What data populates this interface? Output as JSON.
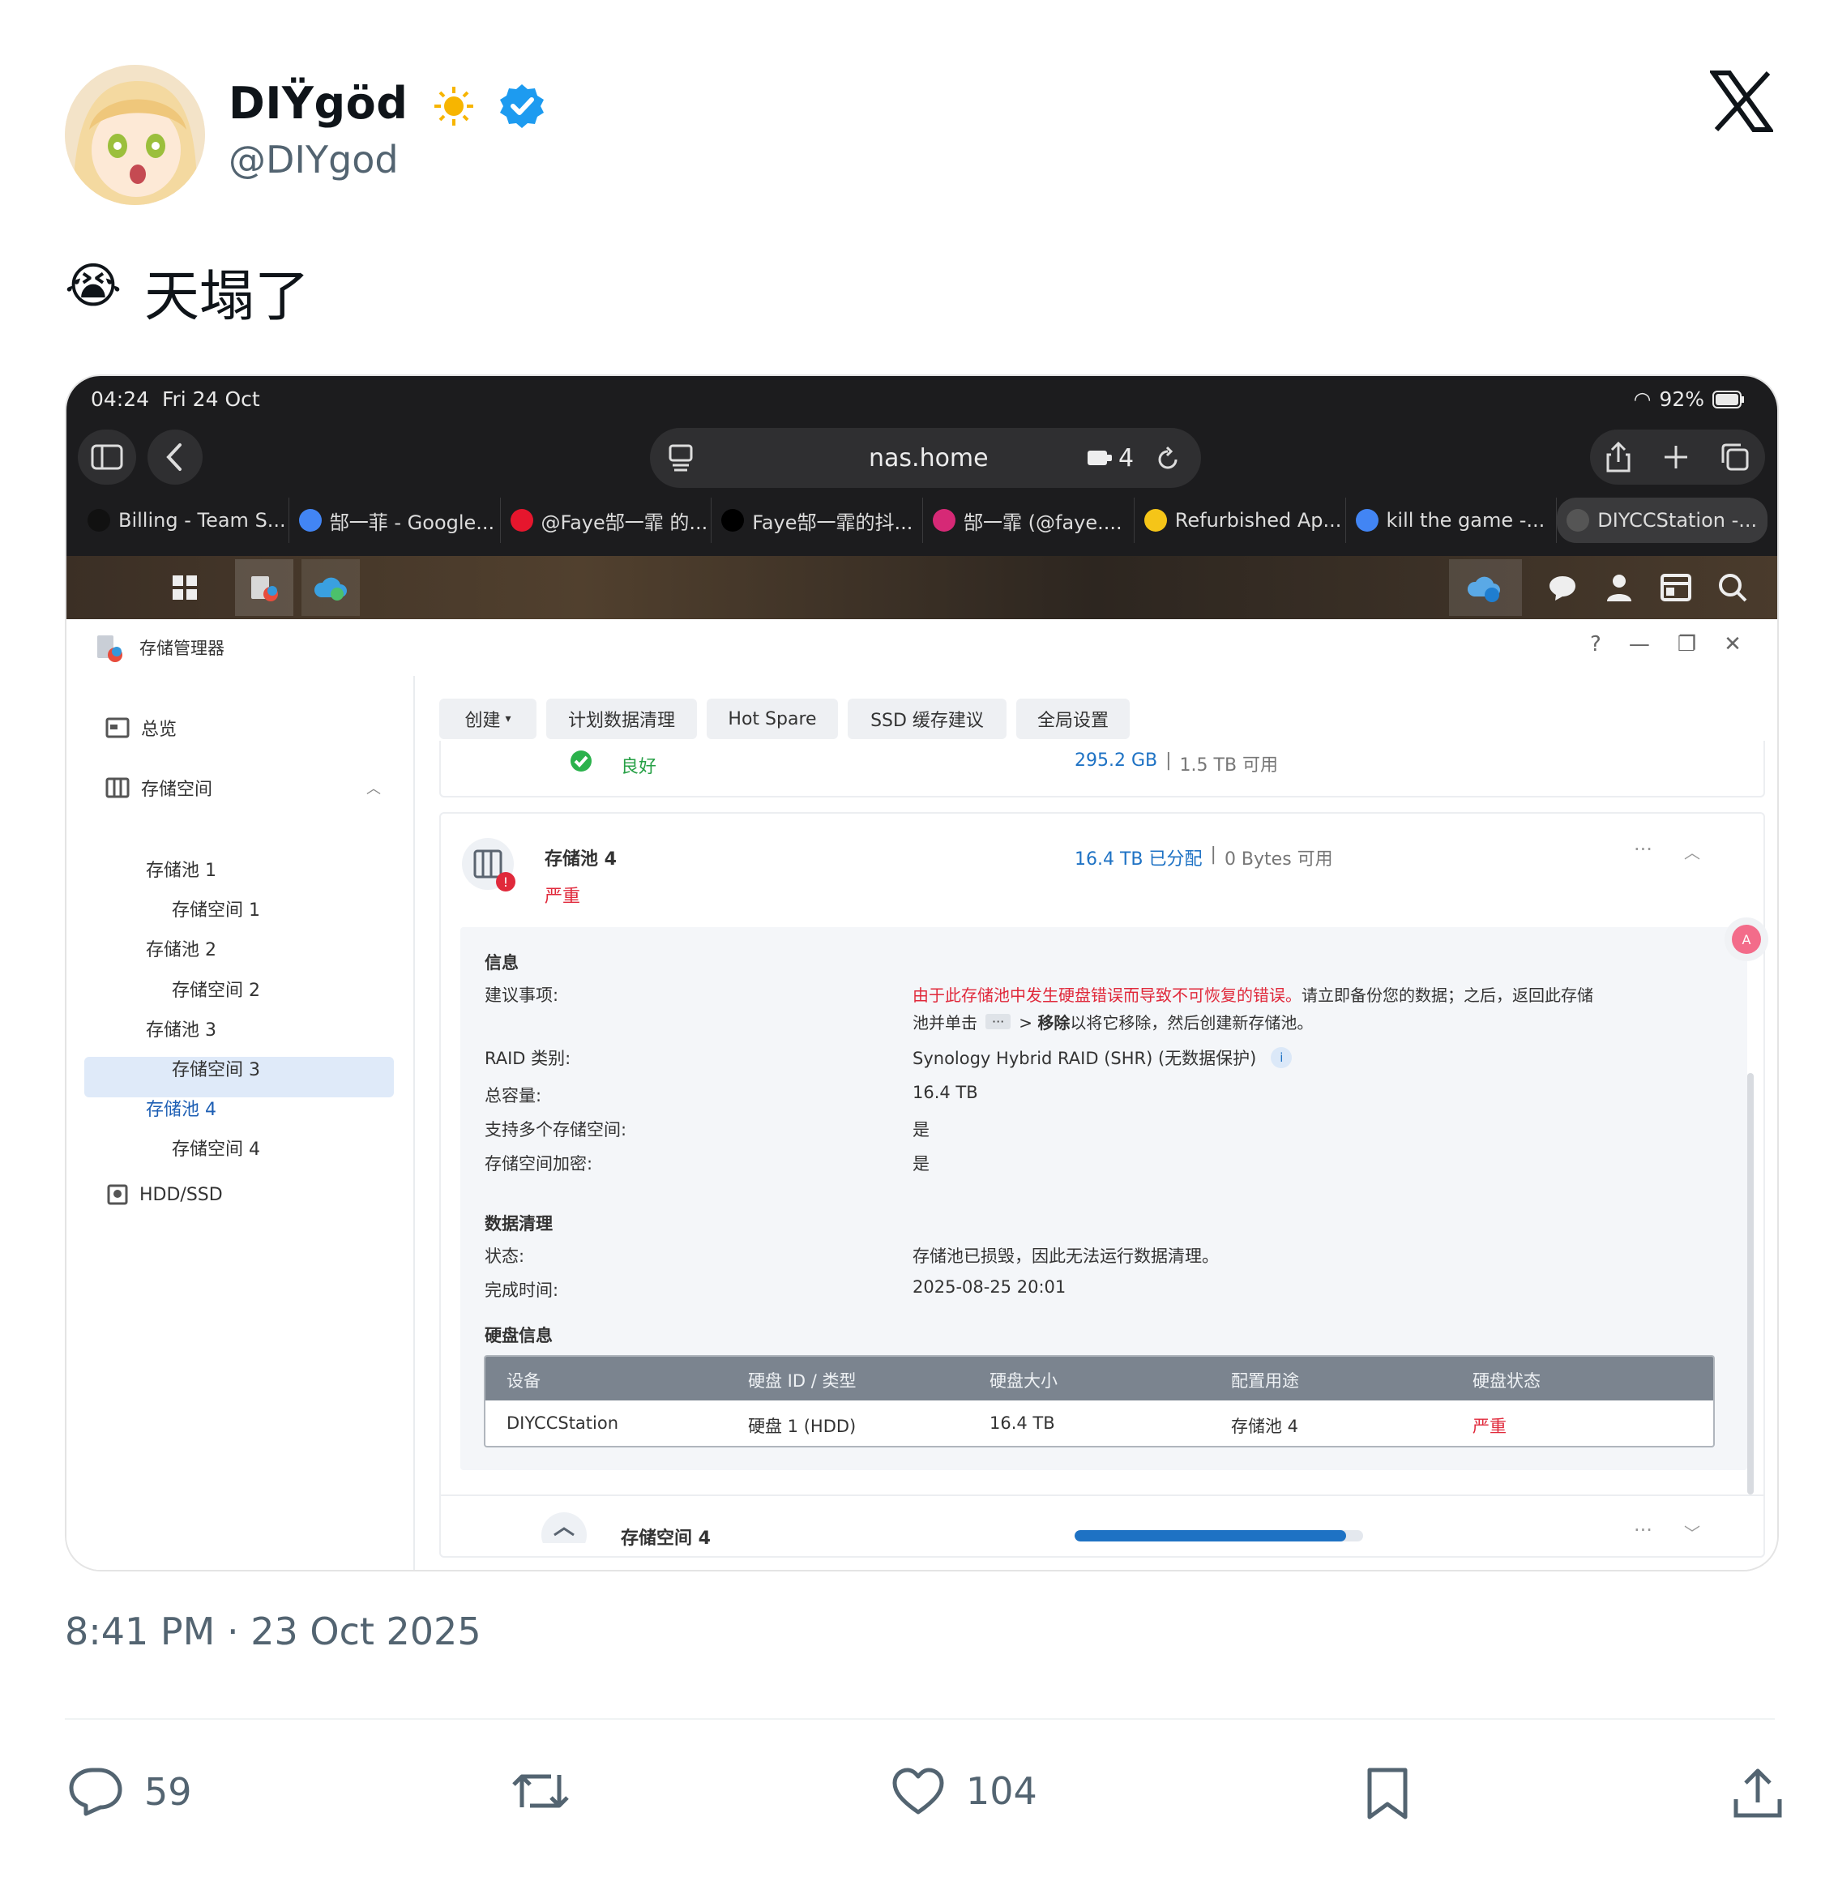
{
  "author": {
    "name": "DIŸgöd",
    "handle": "@DIYgod"
  },
  "tweet": {
    "emoji": "😭",
    "text": "天塌了",
    "timestamp": "8:41 PM · 23 Oct 2025"
  },
  "stats": {
    "replies": "59",
    "likes": "104"
  },
  "device": {
    "time": "04:24",
    "date": "Fri 24 Oct",
    "battery": "92%"
  },
  "browser": {
    "url": "nas.home",
    "tab_count": "4",
    "tabs": [
      {
        "label": "Billing - Team S...",
        "color": "#111111"
      },
      {
        "label": "郜一菲 - Google...",
        "color": "#4285f4"
      },
      {
        "label": "@Faye郜一霏 的...",
        "color": "#e6162d"
      },
      {
        "label": "Faye郜一霏的抖...",
        "color": "#000000"
      },
      {
        "label": "郜一霏 (@faye....",
        "color": "#d62976"
      },
      {
        "label": "Refurbished Ap...",
        "color": "#f5c518"
      },
      {
        "label": "kill the game -...",
        "color": "#4285f4"
      },
      {
        "label": "DIYCCStation -...",
        "color": "#555555"
      }
    ]
  },
  "app": {
    "title": "存储管理器",
    "toolbar": {
      "create": "创建",
      "scrub": "计划数据清理",
      "hotspare": "Hot Spare",
      "ssd": "SSD 缓存建议",
      "global": "全局设置"
    },
    "sidebar": {
      "overview": "总览",
      "storage": "存储空间",
      "pools": [
        "存储池 1",
        "存储空间 1",
        "存储池 2",
        "存储空间 2",
        "存储池 3",
        "存储空间 3",
        "存储池 4",
        "存储空间 4"
      ],
      "hdd": "HDD/SSD"
    },
    "prev": {
      "status": "良好",
      "used": "295.2 GB",
      "sep": "|",
      "avail": "1.5 TB 可用"
    },
    "pool4": {
      "name": "存储池 4",
      "status": "严重",
      "allocated": "16.4 TB 已分配",
      "sep": "|",
      "avail": "0 Bytes 可用",
      "info_title": "信息",
      "advice_label": "建议事项:",
      "advice_red": "由于此存储池中发生硬盘错误而导致不可恢复的错误。",
      "advice_rest": "请立即备份您的数据；之后，返回此存储",
      "advice_line2a": "池并单击",
      "advice_dots": "···",
      "advice_line2b": "> ",
      "advice_bold": "移除",
      "advice_line2c": "以将它移除，然后创建新存储池。",
      "raid_label": "RAID 类别:",
      "raid_val": "Synology Hybrid RAID (SHR) (无数据保护)",
      "cap_label": "总容量:",
      "cap_val": "16.4 TB",
      "multi_label": "支持多个存储空间:",
      "multi_val": "是",
      "enc_label": "存储空间加密:",
      "enc_val": "是",
      "scrub_title": "数据清理",
      "state_label": "状态:",
      "state_val": "存储池已损毁，因此无法运行数据清理。",
      "done_label": "完成时间:",
      "done_val": "2025-08-25 20:01",
      "disk_title": "硬盘信息"
    },
    "disk_table": {
      "headers": [
        "设备",
        "硬盘 ID / 类型",
        "硬盘大小",
        "配置用途",
        "硬盘状态"
      ],
      "row": [
        "DIYCCStation",
        "硬盘 1 (HDD)",
        "16.4 TB",
        "存储池 4",
        "严重"
      ]
    },
    "volume4": {
      "name": "存储空间 4",
      "progress": 0.94
    }
  }
}
